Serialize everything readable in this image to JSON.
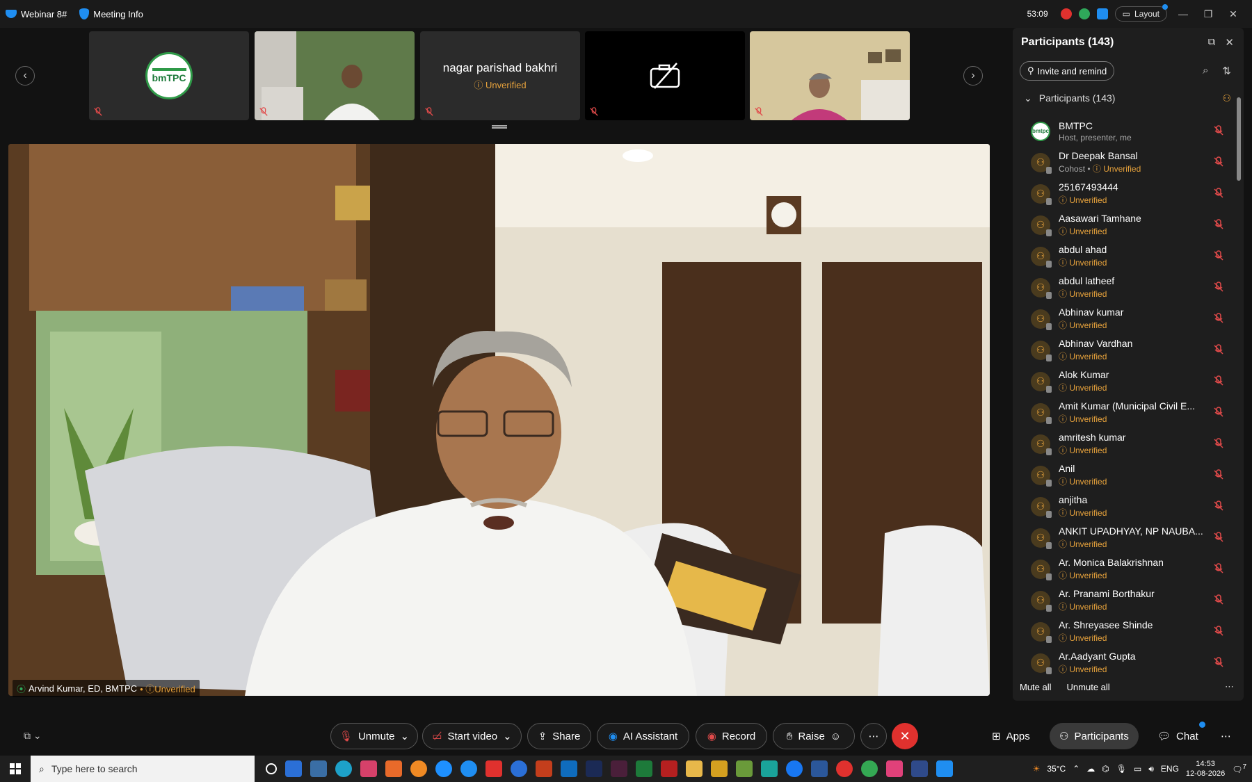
{
  "topbar": {
    "app_title": "Webinar 8#",
    "meeting_info": "Meeting Info",
    "timer": "53:09",
    "layout_label": "Layout"
  },
  "thumbnails": [
    {
      "type": "logo",
      "logo_text": "bmTPC"
    },
    {
      "type": "video"
    },
    {
      "type": "name",
      "name": "nagar parishad bakhri",
      "status": "Unverified"
    },
    {
      "type": "camera-off"
    },
    {
      "type": "video"
    }
  ],
  "main_video": {
    "speaker_label": "Arvind Kumar, ED, BMTPC",
    "speaker_status": "Unverified"
  },
  "participants_panel": {
    "title": "Participants (143)",
    "invite_label": "Invite and remind",
    "group_label": "Participants (143)",
    "participants": [
      {
        "name": "BMTPC",
        "sub": "Host, presenter, me",
        "status": "",
        "host": true
      },
      {
        "name": "Dr Deepak Bansal",
        "sub": "Cohost •",
        "status": "Unverified"
      },
      {
        "name": "25167493444",
        "sub": "",
        "status": "Unverified"
      },
      {
        "name": "Aasawari Tamhane",
        "sub": "",
        "status": "Unverified"
      },
      {
        "name": "abdul ahad",
        "sub": "",
        "status": "Unverified"
      },
      {
        "name": "abdul latheef",
        "sub": "",
        "status": "Unverified"
      },
      {
        "name": "Abhinav kumar",
        "sub": "",
        "status": "Unverified"
      },
      {
        "name": "Abhinav Vardhan",
        "sub": "",
        "status": "Unverified"
      },
      {
        "name": "Alok Kumar",
        "sub": "",
        "status": "Unverified"
      },
      {
        "name": "Amit Kumar (Municipal Civil E...",
        "sub": "",
        "status": "Unverified"
      },
      {
        "name": "amritesh kumar",
        "sub": "",
        "status": "Unverified"
      },
      {
        "name": "Anil",
        "sub": "",
        "status": "Unverified"
      },
      {
        "name": "anjitha",
        "sub": "",
        "status": "Unverified"
      },
      {
        "name": "ANKIT UPADHYAY, NP NAUBA...",
        "sub": "",
        "status": "Unverified"
      },
      {
        "name": "Ar. Monica Balakrishnan",
        "sub": "",
        "status": "Unverified"
      },
      {
        "name": "Ar. Pranami Borthakur",
        "sub": "",
        "status": "Unverified"
      },
      {
        "name": "Ar. Shreyasee Shinde",
        "sub": "",
        "status": "Unverified"
      },
      {
        "name": "Ar.Aadyant Gupta",
        "sub": "",
        "status": "Unverified"
      }
    ],
    "mute_all": "Mute all",
    "unmute_all": "Unmute all"
  },
  "controls": {
    "unmute": "Unmute",
    "start_video": "Start video",
    "share": "Share",
    "ai_assistant": "AI Assistant",
    "record": "Record",
    "raise": "Raise",
    "apps": "Apps",
    "participants": "Participants",
    "chat": "Chat"
  },
  "taskbar": {
    "search_placeholder": "Type here to search",
    "temperature": "35°C",
    "language": "ENG",
    "time": "14:53",
    "date": "12-08-2026",
    "notification_count": "7"
  },
  "colors": {
    "accent": "#1f8ef1",
    "unverified": "#e8a33c",
    "end_button": "#e0312e",
    "muted_icon": "#e04a4a"
  }
}
